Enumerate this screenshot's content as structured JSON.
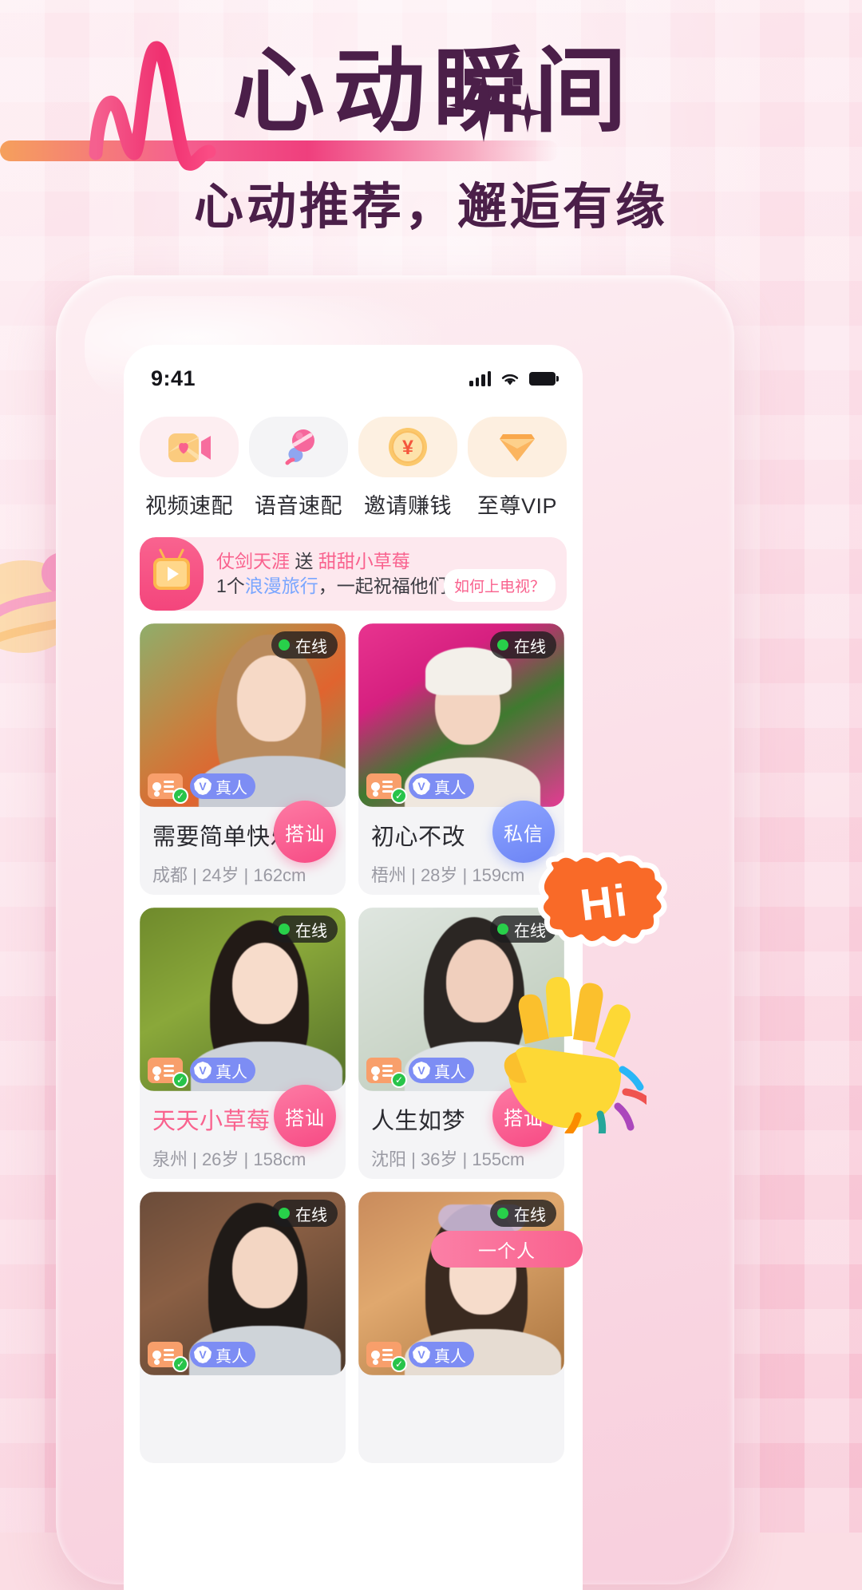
{
  "poster": {
    "title": "心动瞬间",
    "subtitle": "心动推荐，邂逅有缘",
    "accent_pink": "#f9628e",
    "accent_purple": "#4b1f49"
  },
  "status_bar": {
    "time": "9:41",
    "signal_icon": "signal-bars-icon",
    "wifi_icon": "wifi-icon",
    "battery_icon": "battery-icon"
  },
  "quick_actions": [
    {
      "label": "视频速配",
      "icon": "video-heart-icon"
    },
    {
      "label": "语音速配",
      "icon": "microphone-icon"
    },
    {
      "label": "邀请赚钱",
      "icon": "yen-coin-icon"
    },
    {
      "label": "至尊VIP",
      "icon": "vip-diamond-icon"
    }
  ],
  "gift_banner": {
    "icon": "tv-play-icon",
    "sender": "仗剑天涯",
    "verb": "送",
    "receiver": "甜甜小草莓",
    "count": "1个",
    "gift_name": "浪漫旅行",
    "tail": "，一起祝福他们吧！",
    "button_label": "如何上电视？"
  },
  "badges": {
    "online_label": "在线",
    "real_label": "真人",
    "id_verified_icon": "id-card-verified-icon",
    "real_person_icon": "real-person-badge-icon"
  },
  "cards": [
    {
      "name": "需要简单快乐",
      "city": "成都",
      "age": "24岁",
      "height": "162cm",
      "meta": "成都 | 24岁 | 162cm",
      "online": "在线",
      "action_label": "搭讪",
      "action_type": "pink",
      "name_highlight": false
    },
    {
      "name": "初心不改",
      "city": "梧州",
      "age": "28岁",
      "height": "159cm",
      "meta": "梧州 | 28岁 | 159cm",
      "online": "在线",
      "action_label": "私信",
      "action_type": "blue",
      "name_highlight": false
    },
    {
      "name": "天天小草莓",
      "city": "泉州",
      "age": "26岁",
      "height": "158cm",
      "meta": "泉州 | 26岁 | 158cm",
      "online": "在线",
      "action_label": "搭讪",
      "action_type": "pink",
      "name_highlight": true
    },
    {
      "name": "人生如梦",
      "city": "沈阳",
      "age": "36岁",
      "height": "155cm",
      "meta": "沈阳 | 36岁 | 155cm",
      "online": "在线",
      "action_label": "搭讪",
      "action_type": "pink",
      "name_highlight": false
    },
    {
      "name": "",
      "city": "",
      "age": "",
      "height": "",
      "meta": "",
      "online": "在线",
      "action_label": "",
      "action_type": "pink",
      "name_highlight": false
    },
    {
      "name": "",
      "city": "",
      "age": "",
      "height": "",
      "meta": "",
      "online": "在线",
      "action_label": "",
      "action_type": "pink",
      "name_highlight": false
    }
  ],
  "stickers": {
    "hi_bubble_text": "Hi",
    "hi_bubble_color": "#f96a28",
    "hand_icon": "waving-hand-icon",
    "bottom_pill_text": "一个人"
  }
}
